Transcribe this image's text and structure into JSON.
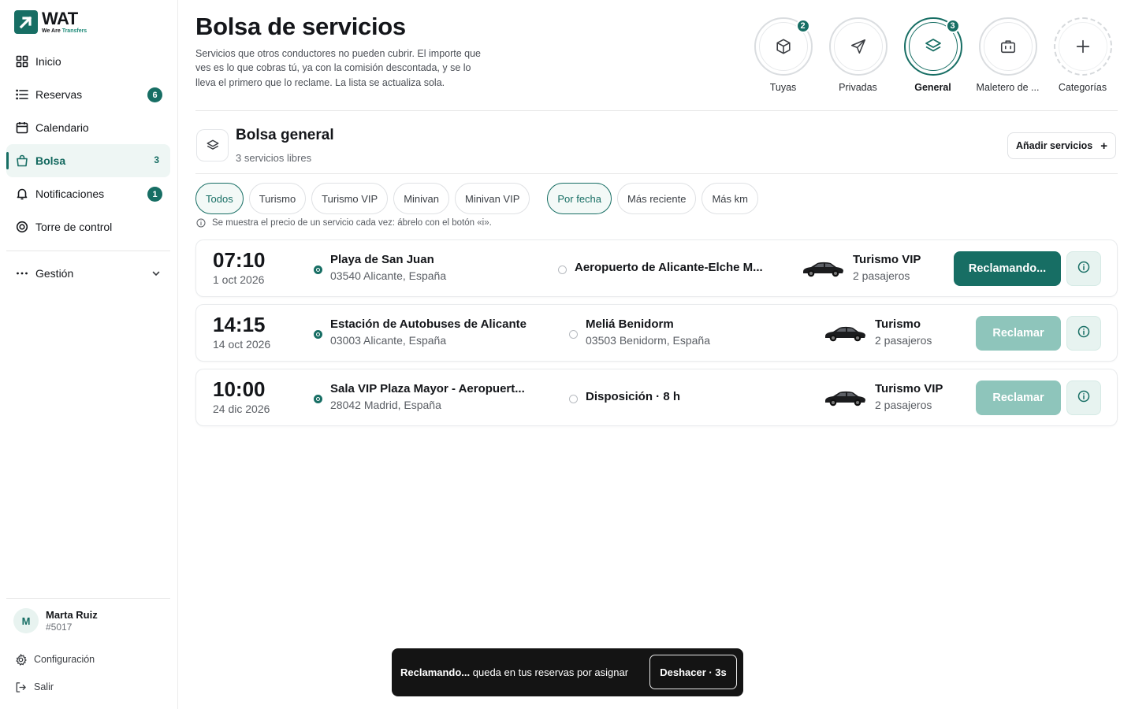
{
  "brand": {
    "name": "WAT",
    "tagline_part1": "We Are ",
    "tagline_part2": "Transfers",
    "accent": "#176e64"
  },
  "sidebar": {
    "items": [
      {
        "label": "Inicio",
        "icon": "grid-icon"
      },
      {
        "label": "Reservas",
        "icon": "list-icon",
        "badge": "6"
      },
      {
        "label": "Calendario",
        "icon": "calendar-icon"
      },
      {
        "label": "Bolsa",
        "icon": "bag-icon",
        "count": "3",
        "active": true
      },
      {
        "label": "Notificaciones",
        "icon": "bell-icon",
        "badge": "1"
      },
      {
        "label": "Torre de control",
        "icon": "target-icon"
      }
    ],
    "gestion": {
      "label": "Gestión",
      "icon": "more-icon"
    },
    "user": {
      "initial": "M",
      "name": "Marta Ruiz",
      "id": "#5017"
    },
    "settings_label": "Configuración",
    "logout_label": "Salir"
  },
  "header": {
    "title": "Bolsa de servicios",
    "description": "Servicios que otros conductores no pueden cubrir. El importe que ves es lo que cobras tú, ya con la comisión descontada, y se lo lleva el primero que lo reclame. La lista se actualiza sola."
  },
  "categories": [
    {
      "label": "Tuyas",
      "icon": "box-icon",
      "badge": "2"
    },
    {
      "label": "Privadas",
      "icon": "send-icon"
    },
    {
      "label": "General",
      "icon": "layers-icon",
      "badge": "3",
      "active": true
    },
    {
      "label": "Maletero de ...",
      "icon": "luggage-icon"
    },
    {
      "label": "Categorías",
      "icon": "plus-icon"
    }
  ],
  "section": {
    "title": "Bolsa general",
    "subtitle": "3 servicios libres",
    "add_label": "Añadir servicios",
    "add_icon": "+"
  },
  "filters": {
    "types": [
      "Todos",
      "Turismo",
      "Turismo VIP",
      "Minivan",
      "Minivan VIP"
    ],
    "active_type": "Todos",
    "sorts": [
      "Por fecha",
      "Más reciente",
      "Más km"
    ],
    "active_sort": "Por fecha",
    "hint": "Se muestra el precio de un servicio cada vez: ábrelo con el botón «i»."
  },
  "services": [
    {
      "time": "07:10",
      "date": "1 oct 2026",
      "from": "Playa de San Juan",
      "from_addr": "03540 Alicante, España",
      "to": "Aeropuerto de Alicante-Elche M...",
      "to_addr": "",
      "vehicle": "Turismo VIP",
      "passengers": "2 pasajeros",
      "action": "Reclamando...",
      "state": "claiming"
    },
    {
      "time": "14:15",
      "date": "14 oct 2026",
      "from": "Estación de Autobuses de Alicante",
      "from_addr": "03003 Alicante, España",
      "to": "Meliá Benidorm",
      "to_addr": "03503 Benidorm, España",
      "vehicle": "Turismo",
      "passengers": "2 pasajeros",
      "action": "Reclamar",
      "state": "disabled"
    },
    {
      "time": "10:00",
      "date": "24 dic 2026",
      "from": "Sala VIP Plaza Mayor - Aeropuert...",
      "from_addr": "28042 Madrid, España",
      "to": "Disposición · 8 h",
      "to_addr": "",
      "vehicle": "Turismo VIP",
      "passengers": "2 pasajeros",
      "action": "Reclamar",
      "state": "disabled"
    }
  ],
  "toast": {
    "bold": "Reclamando...",
    "text": " queda en tus reservas por asignar",
    "undo_label": "Deshacer · 3s"
  }
}
